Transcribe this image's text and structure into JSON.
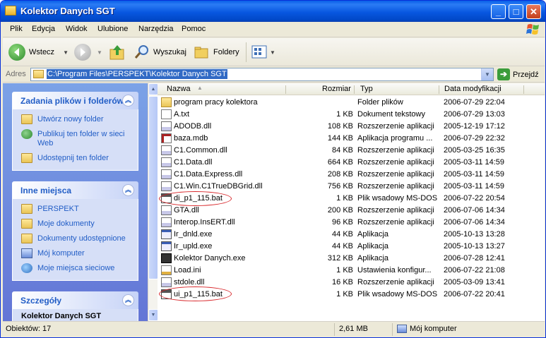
{
  "window": {
    "title": "Kolektor Danych SGT",
    "controls": {
      "minimize": "_",
      "maximize": "□",
      "close": "✕"
    }
  },
  "menu": [
    "Plik",
    "Edycja",
    "Widok",
    "Ulubione",
    "Narzędzia",
    "Pomoc"
  ],
  "toolbar": {
    "back": "Wstecz",
    "search": "Wyszukaj",
    "folders": "Foldery"
  },
  "address": {
    "label": "Adres",
    "path": "C:\\Program Files\\PERSPEKT\\Kolektor Danych SGT",
    "go": "Przejdź"
  },
  "sidebar": {
    "tasks": {
      "title": "Zadania plików i folderów",
      "items": [
        {
          "label": "Utwórz nowy folder",
          "icon": "new-folder-icon"
        },
        {
          "label": "Publikuj ten folder w sieci Web",
          "icon": "publish-web-icon"
        },
        {
          "label": "Udostępnij ten folder",
          "icon": "share-folder-icon"
        }
      ]
    },
    "places": {
      "title": "Inne miejsca",
      "items": [
        {
          "label": "PERSPEKT",
          "icon": "folder-icon"
        },
        {
          "label": "Moje dokumenty",
          "icon": "folder-icon"
        },
        {
          "label": "Dokumenty udostępnione",
          "icon": "folder-icon"
        },
        {
          "label": "Mój komputer",
          "icon": "computer-icon"
        },
        {
          "label": "Moje miejsca sieciowe",
          "icon": "network-icon"
        }
      ]
    },
    "details": {
      "title": "Szczegóły",
      "name": "Kolektor Danych SGT"
    }
  },
  "columns": {
    "name": "Nazwa",
    "size": "Rozmiar",
    "type": "Typ",
    "modified": "Data modyfikacji"
  },
  "files": [
    {
      "name": "program pracy kolektora",
      "size": "",
      "type": "Folder plików",
      "date": "2006-07-29 22:04",
      "icon": "folder"
    },
    {
      "name": "A.txt",
      "size": "1 KB",
      "type": "Dokument tekstowy",
      "date": "2006-07-29 13:03",
      "icon": "txt"
    },
    {
      "name": "ADODB.dll",
      "size": "108 KB",
      "type": "Rozszerzenie aplikacji",
      "date": "2005-12-19 17:12",
      "icon": "dll"
    },
    {
      "name": "baza.mdb",
      "size": "144 KB",
      "type": "Aplikacja programu ...",
      "date": "2006-07-29 22:32",
      "icon": "mdb"
    },
    {
      "name": "C1.Common.dll",
      "size": "84 KB",
      "type": "Rozszerzenie aplikacji",
      "date": "2005-03-25 16:35",
      "icon": "dll"
    },
    {
      "name": "C1.Data.dll",
      "size": "664 KB",
      "type": "Rozszerzenie aplikacji",
      "date": "2005-03-11 14:59",
      "icon": "dll"
    },
    {
      "name": "C1.Data.Express.dll",
      "size": "208 KB",
      "type": "Rozszerzenie aplikacji",
      "date": "2005-03-11 14:59",
      "icon": "dll"
    },
    {
      "name": "C1.Win.C1TrueDBGrid.dll",
      "size": "756 KB",
      "type": "Rozszerzenie aplikacji",
      "date": "2005-03-11 14:59",
      "icon": "dll"
    },
    {
      "name": "di_p1_115.bat",
      "size": "1 KB",
      "type": "Plik wsadowy MS-DOS",
      "date": "2006-07-22 20:54",
      "icon": "bat"
    },
    {
      "name": "GTA.dll",
      "size": "200 KB",
      "type": "Rozszerzenie aplikacji",
      "date": "2006-07-06 14:34",
      "icon": "dll"
    },
    {
      "name": "Interop.InsERT.dll",
      "size": "96 KB",
      "type": "Rozszerzenie aplikacji",
      "date": "2006-07-06 14:34",
      "icon": "dll"
    },
    {
      "name": "Ir_dnld.exe",
      "size": "44 KB",
      "type": "Aplikacja",
      "date": "2005-10-13 13:28",
      "icon": "exe"
    },
    {
      "name": "Ir_upld.exe",
      "size": "44 KB",
      "type": "Aplikacja",
      "date": "2005-10-13 13:27",
      "icon": "exe"
    },
    {
      "name": "Kolektor Danych.exe",
      "size": "312 KB",
      "type": "Aplikacja",
      "date": "2006-07-28 12:41",
      "icon": "exe2"
    },
    {
      "name": "Load.ini",
      "size": "1 KB",
      "type": "Ustawienia konfigur...",
      "date": "2006-07-22 21:08",
      "icon": "ini"
    },
    {
      "name": "stdole.dll",
      "size": "16 KB",
      "type": "Rozszerzenie aplikacji",
      "date": "2005-03-09 13:41",
      "icon": "dll"
    },
    {
      "name": "ui_p1_115.bat",
      "size": "1 KB",
      "type": "Plik wsadowy MS-DOS",
      "date": "2006-07-22 20:41",
      "icon": "bat"
    }
  ],
  "status": {
    "objects": "Obiektów: 17",
    "size": "2,61 MB",
    "location": "Mój komputer"
  }
}
